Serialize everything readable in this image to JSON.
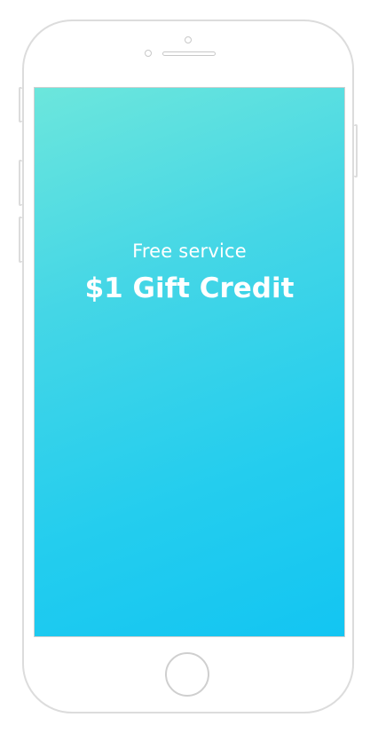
{
  "screen": {
    "subtitle": "Free service",
    "title": "$1 Gift Credit",
    "gradient_start": "#6ce6dc",
    "gradient_end": "#13c5f2"
  },
  "device": {
    "frame_color": "#dcdcdc"
  }
}
